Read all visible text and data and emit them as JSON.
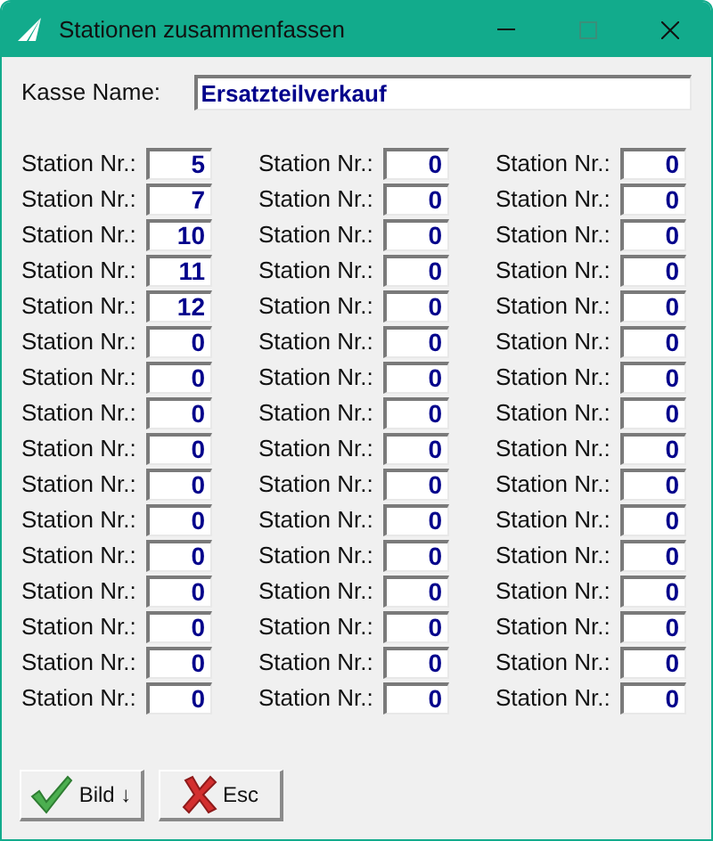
{
  "window": {
    "title": "Stationen zusammenfassen"
  },
  "kasse": {
    "label": "Kasse Name:",
    "value": "Ersatzteilverkauf"
  },
  "station_columns": [
    [
      {
        "label": "Station Nr.:",
        "value": "5"
      },
      {
        "label": "Station Nr.:",
        "value": "7"
      },
      {
        "label": "Station Nr.:",
        "value": "10"
      },
      {
        "label": "Station Nr.:",
        "value": "11"
      },
      {
        "label": "Station Nr.:",
        "value": "12"
      },
      {
        "label": "Station Nr.:",
        "value": "0"
      },
      {
        "label": "Station Nr.:",
        "value": "0"
      },
      {
        "label": "Station Nr.:",
        "value": "0"
      },
      {
        "label": "Station Nr.:",
        "value": "0"
      },
      {
        "label": "Station Nr.:",
        "value": "0"
      },
      {
        "label": "Station Nr.:",
        "value": "0"
      },
      {
        "label": "Station Nr.:",
        "value": "0"
      },
      {
        "label": "Station Nr.:",
        "value": "0"
      },
      {
        "label": "Station Nr.:",
        "value": "0"
      },
      {
        "label": "Station Nr.:",
        "value": "0"
      },
      {
        "label": "Station Nr.:",
        "value": "0"
      }
    ],
    [
      {
        "label": "Station Nr.:",
        "value": "0"
      },
      {
        "label": "Station Nr.:",
        "value": "0"
      },
      {
        "label": "Station Nr.:",
        "value": "0"
      },
      {
        "label": "Station Nr.:",
        "value": "0"
      },
      {
        "label": "Station Nr.:",
        "value": "0"
      },
      {
        "label": "Station Nr.:",
        "value": "0"
      },
      {
        "label": "Station Nr.:",
        "value": "0"
      },
      {
        "label": "Station Nr.:",
        "value": "0"
      },
      {
        "label": "Station Nr.:",
        "value": "0"
      },
      {
        "label": "Station Nr.:",
        "value": "0"
      },
      {
        "label": "Station Nr.:",
        "value": "0"
      },
      {
        "label": "Station Nr.:",
        "value": "0"
      },
      {
        "label": "Station Nr.:",
        "value": "0"
      },
      {
        "label": "Station Nr.:",
        "value": "0"
      },
      {
        "label": "Station Nr.:",
        "value": "0"
      },
      {
        "label": "Station Nr.:",
        "value": "0"
      }
    ],
    [
      {
        "label": "Station Nr.:",
        "value": "0"
      },
      {
        "label": "Station Nr.:",
        "value": "0"
      },
      {
        "label": "Station Nr.:",
        "value": "0"
      },
      {
        "label": "Station Nr.:",
        "value": "0"
      },
      {
        "label": "Station Nr.:",
        "value": "0"
      },
      {
        "label": "Station Nr.:",
        "value": "0"
      },
      {
        "label": "Station Nr.:",
        "value": "0"
      },
      {
        "label": "Station Nr.:",
        "value": "0"
      },
      {
        "label": "Station Nr.:",
        "value": "0"
      },
      {
        "label": "Station Nr.:",
        "value": "0"
      },
      {
        "label": "Station Nr.:",
        "value": "0"
      },
      {
        "label": "Station Nr.:",
        "value": "0"
      },
      {
        "label": "Station Nr.:",
        "value": "0"
      },
      {
        "label": "Station Nr.:",
        "value": "0"
      },
      {
        "label": "Station Nr.:",
        "value": "0"
      },
      {
        "label": "Station Nr.:",
        "value": "0"
      }
    ]
  ],
  "buttons": [
    {
      "kind": "ok",
      "label": "Bild ↓"
    },
    {
      "kind": "cancel",
      "label": "Esc"
    }
  ]
}
